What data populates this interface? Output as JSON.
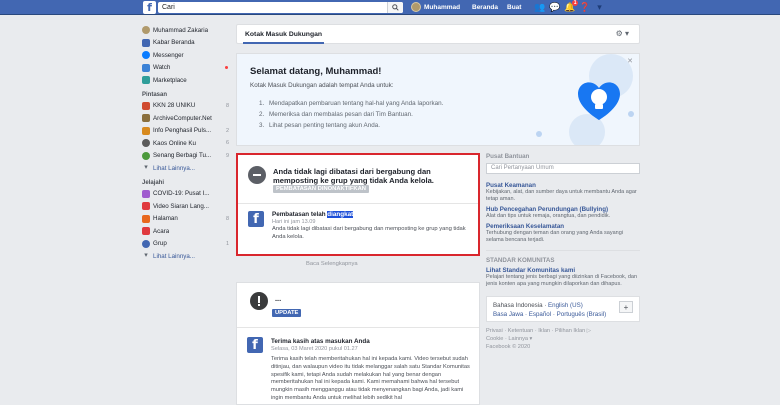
{
  "topbar": {
    "logo": "f",
    "search_value": "Cari",
    "user_name": "Muhammad",
    "home_label": "Beranda",
    "create_label": "Buat",
    "notif_count": "1"
  },
  "sidebar": {
    "profile_name": "Muhammad Zakaria",
    "main_items": [
      {
        "label": "Kabar Beranda"
      },
      {
        "label": "Messenger"
      },
      {
        "label": "Watch"
      },
      {
        "label": "Marketplace"
      }
    ],
    "shortcuts_heading": "Pintasan",
    "shortcuts": [
      {
        "label": "KKN 28 UNIKU",
        "count": "8"
      },
      {
        "label": "ArchiveComputer.Net",
        "count": ""
      },
      {
        "label": "Info Penghasil Puls...",
        "count": "2"
      },
      {
        "label": "Kaos Online Ku",
        "count": "6"
      },
      {
        "label": "Senang Berbagi Tu...",
        "count": "9"
      }
    ],
    "shortcuts_more": "Lihat Lainnya...",
    "explore_heading": "Jelajahi",
    "explore": [
      {
        "label": "COVID-19: Pusat I...",
        "count": ""
      },
      {
        "label": "Video Siaran Lang...",
        "count": ""
      },
      {
        "label": "Halaman",
        "count": "8"
      },
      {
        "label": "Acara",
        "count": ""
      },
      {
        "label": "Grup",
        "count": "1"
      }
    ],
    "explore_more": "Lihat Lainnya..."
  },
  "main": {
    "tab_label": "Kotak Masuk Dukungan",
    "welcome": {
      "title": "Selamat datang, Muhammad!",
      "intro": "Kotak Masuk Dukungan adalah tempat Anda untuk:",
      "items": [
        {
          "num": "1.",
          "text": "Mendapatkan pembaruan tentang hal-hal yang Anda laporkan."
        },
        {
          "num": "2.",
          "text": "Memeriksa dan membalas pesan dari Tim Bantuan."
        },
        {
          "num": "3.",
          "text": "Lihat pesan penting tentang akun Anda."
        }
      ]
    },
    "restriction": {
      "title": "Anda tidak lagi dibatasi dari bergabung dan memposting ke grup yang tidak Anda kelola.",
      "status": "PEMBATASAN DINONAKTIFKAN",
      "notice_title_a": "Pembatasan telah ",
      "notice_title_b": "diangkat",
      "notice_time": "Hari ini jam 13.09",
      "notice_body": "Anda tidak lagi dibatasi dari bergabung dan memposting ke grup yang tidak Anda kelola."
    },
    "more_link": "Baca Selengkapnya",
    "update": {
      "title": "...",
      "status": "UPDATE",
      "sub_title": "Terima kasih atas masukan Anda",
      "time": "Selasa, 03 Maret 2020 pukul 01.27",
      "body": "Terima kasih telah memberitahukan hal ini kepada kami. Video tersebut sudah ditinjau, dan walaupun video itu tidak melanggar salah satu Standar Komunitas spesifik kami, tetapi Anda sudah melakukan hal yang benar dengan memberitahukan hal ini kepada kami. Kami memahami bahwa hal tersebut mungkin masih mengganggu atau tidak menyenangkan bagi Anda, jadi kami ingin membantu Anda untuk melihat lebih sedikit hal"
    }
  },
  "right": {
    "help_heading": "Pusat Bantuan",
    "search_placeholder": "Cari Pertanyaan Umum",
    "links": [
      {
        "title": "Pusat Keamanan",
        "desc": "Kebijakan, alat, dan sumber daya untuk membantu Anda agar tetap aman."
      },
      {
        "title": "Hub Pencegahan Perundungan (Bullying)",
        "desc": "Alat dan tips untuk remaja, orangtua, dan pendidik."
      },
      {
        "title": "Pemeriksaan Keselamatan",
        "desc": "Terhubung dengan teman dan orang yang Anda sayangi selama bencana terjadi."
      }
    ],
    "community_heading": "STANDAR KOMUNITAS",
    "community_link": "Lihat Standar Komunitas kami",
    "community_desc": "Pelajari tentang jenis berbagi yang diizinkan di Facebook, dan jenis konten apa yang mungkin dilaporkan dan dihapus.",
    "languages_line1_a": "Bahasa Indonesia",
    "languages_line1_b": "English (US)",
    "languages_line2": "Basa Jawa · Español · Português (Brasil)",
    "lang_plus": "+",
    "footer_line1": "Privasi · Ketentuan · Iklan · Pilihan Iklan ▷",
    "footer_line2": "Cookie · Lainnya ▾",
    "footer_line3": "Facebook © 2020"
  },
  "colors": {
    "brand": "#4267b2",
    "alert_border": "#d9262d",
    "link": "#385898"
  }
}
